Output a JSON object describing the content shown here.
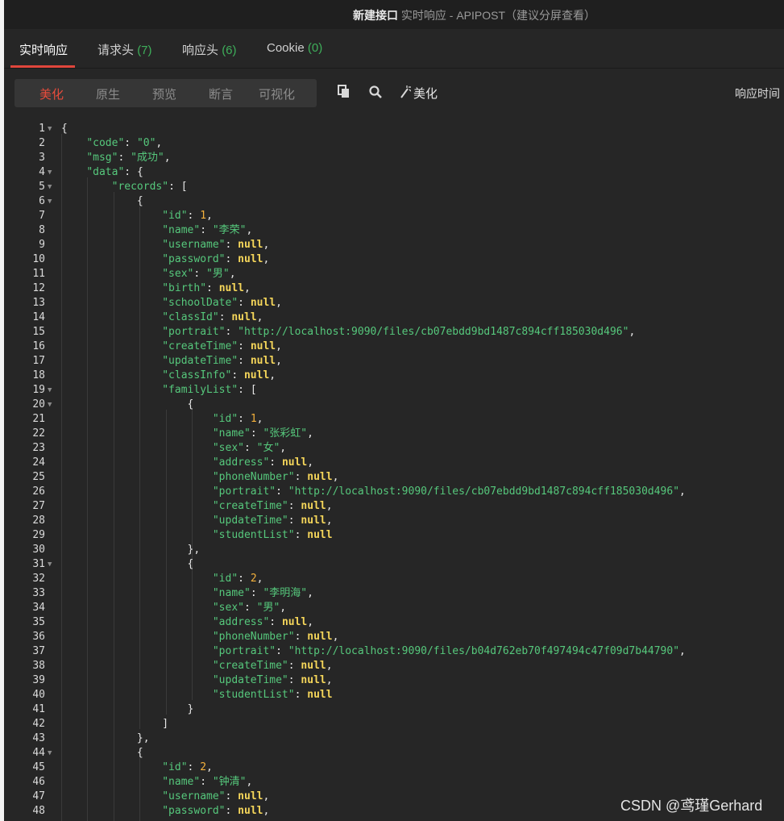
{
  "window": {
    "title_main": "新建接口",
    "title_rest": " 实时响应 - APIPOST（建议分屏查看）"
  },
  "tabs": [
    {
      "label": "实时响应",
      "count": ""
    },
    {
      "label": "请求头",
      "count": "(7)"
    },
    {
      "label": "响应头",
      "count": "(6)"
    },
    {
      "label": "Cookie",
      "count": "(0)"
    }
  ],
  "view_modes": [
    "美化",
    "原生",
    "预览",
    "断言",
    "可视化"
  ],
  "toolbar": {
    "beautify_label": "美化",
    "response_time_label": "响应时间",
    "icons": [
      "copy-icon",
      "search-icon",
      "magic-wand-icon"
    ]
  },
  "colors": {
    "accent": "#e74c3c",
    "key_string": "#56c87c",
    "number": "#f5b13c",
    "null": "#f5d65a"
  },
  "code_lines": [
    {
      "n": 1,
      "fold": true,
      "t": "{"
    },
    {
      "n": 2,
      "t": "    \"code\": \"0\","
    },
    {
      "n": 3,
      "t": "    \"msg\": \"成功\","
    },
    {
      "n": 4,
      "fold": true,
      "t": "    \"data\": {"
    },
    {
      "n": 5,
      "fold": true,
      "t": "        \"records\": ["
    },
    {
      "n": 6,
      "fold": true,
      "t": "            {"
    },
    {
      "n": 7,
      "t": "                \"id\": 1,"
    },
    {
      "n": 8,
      "t": "                \"name\": \"李荣\","
    },
    {
      "n": 9,
      "t": "                \"username\": null,"
    },
    {
      "n": 10,
      "t": "                \"password\": null,"
    },
    {
      "n": 11,
      "t": "                \"sex\": \"男\","
    },
    {
      "n": 12,
      "t": "                \"birth\": null,"
    },
    {
      "n": 13,
      "t": "                \"schoolDate\": null,"
    },
    {
      "n": 14,
      "t": "                \"classId\": null,"
    },
    {
      "n": 15,
      "t": "                \"portrait\": \"http://localhost:9090/files/cb07ebdd9bd1487c894cff185030d496\","
    },
    {
      "n": 16,
      "t": "                \"createTime\": null,"
    },
    {
      "n": 17,
      "t": "                \"updateTime\": null,"
    },
    {
      "n": 18,
      "t": "                \"classInfo\": null,"
    },
    {
      "n": 19,
      "fold": true,
      "t": "                \"familyList\": ["
    },
    {
      "n": 20,
      "fold": true,
      "t": "                    {"
    },
    {
      "n": 21,
      "t": "                        \"id\": 1,"
    },
    {
      "n": 22,
      "t": "                        \"name\": \"张彩虹\","
    },
    {
      "n": 23,
      "t": "                        \"sex\": \"女\","
    },
    {
      "n": 24,
      "t": "                        \"address\": null,"
    },
    {
      "n": 25,
      "t": "                        \"phoneNumber\": null,"
    },
    {
      "n": 26,
      "t": "                        \"portrait\": \"http://localhost:9090/files/cb07ebdd9bd1487c894cff185030d496\","
    },
    {
      "n": 27,
      "t": "                        \"createTime\": null,"
    },
    {
      "n": 28,
      "t": "                        \"updateTime\": null,"
    },
    {
      "n": 29,
      "t": "                        \"studentList\": null"
    },
    {
      "n": 30,
      "t": "                    },"
    },
    {
      "n": 31,
      "fold": true,
      "t": "                    {"
    },
    {
      "n": 32,
      "t": "                        \"id\": 2,"
    },
    {
      "n": 33,
      "t": "                        \"name\": \"李明海\","
    },
    {
      "n": 34,
      "t": "                        \"sex\": \"男\","
    },
    {
      "n": 35,
      "t": "                        \"address\": null,"
    },
    {
      "n": 36,
      "t": "                        \"phoneNumber\": null,"
    },
    {
      "n": 37,
      "t": "                        \"portrait\": \"http://localhost:9090/files/b04d762eb70f497494c47f09d7b44790\","
    },
    {
      "n": 38,
      "t": "                        \"createTime\": null,"
    },
    {
      "n": 39,
      "t": "                        \"updateTime\": null,"
    },
    {
      "n": 40,
      "t": "                        \"studentList\": null"
    },
    {
      "n": 41,
      "t": "                    }"
    },
    {
      "n": 42,
      "t": "                ]"
    },
    {
      "n": 43,
      "t": "            },"
    },
    {
      "n": 44,
      "fold": true,
      "t": "            {"
    },
    {
      "n": 45,
      "t": "                \"id\": 2,"
    },
    {
      "n": 46,
      "t": "                \"name\": \"钟清\","
    },
    {
      "n": 47,
      "t": "                \"username\": null,"
    },
    {
      "n": 48,
      "t": "                \"password\": null,"
    }
  ],
  "watermark": "CSDN @鸢瑾Gerhard"
}
